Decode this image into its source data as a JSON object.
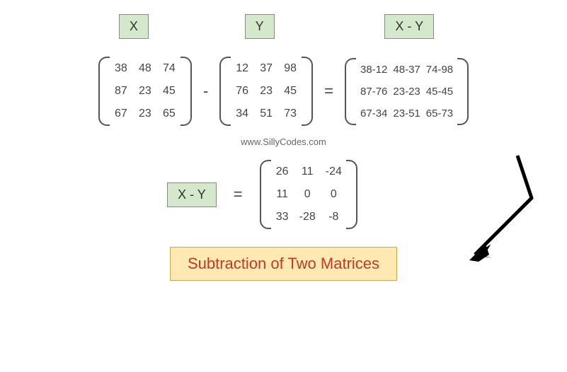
{
  "labels": {
    "x": "X",
    "y": "Y",
    "xy": "X - Y"
  },
  "matrices": {
    "X": [
      [
        "38",
        "48",
        "74"
      ],
      [
        "87",
        "23",
        "45"
      ],
      [
        "67",
        "23",
        "65"
      ]
    ],
    "Y": [
      [
        "12",
        "37",
        "98"
      ],
      [
        "76",
        "23",
        "45"
      ],
      [
        "34",
        "51",
        "73"
      ]
    ],
    "expression": [
      [
        "38-12",
        "48-37",
        "74-98"
      ],
      [
        "87-76",
        "23-23",
        "45-45"
      ],
      [
        "67-34",
        "23-51",
        "65-73"
      ]
    ],
    "result": [
      [
        "26",
        "11",
        "-24"
      ],
      [
        "11",
        "0",
        "0"
      ],
      [
        "33",
        "-28",
        "-8"
      ]
    ]
  },
  "operators": {
    "minus": "-",
    "equals": "="
  },
  "website": "www.SillyCodes.com",
  "title": "Subtraction of Two Matrices"
}
